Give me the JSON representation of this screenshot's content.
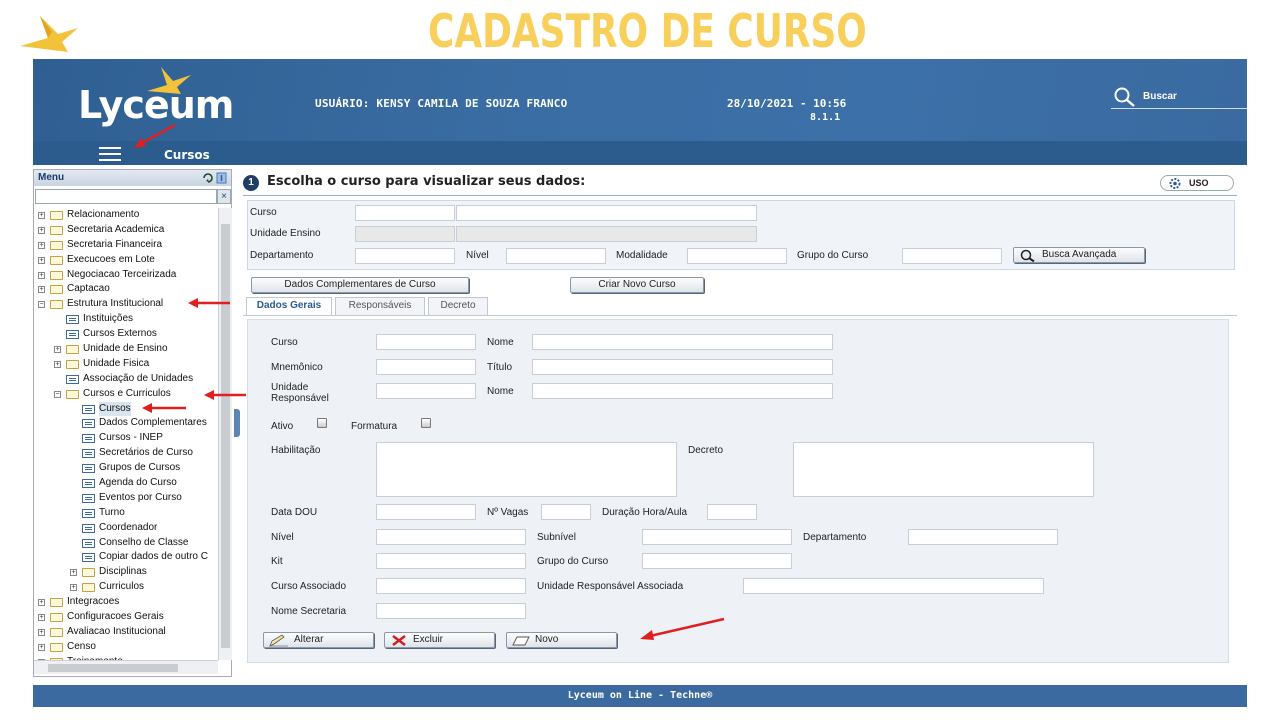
{
  "slide": {
    "title": "CADASTRO DE CURSO"
  },
  "header": {
    "brand": "Lyceum",
    "user": "USUÁRIO: KENSY CAMILA DE SOUZA FRANCO",
    "datetime": "28/10/2021 - 10:56",
    "version": "8.1.1",
    "search_label": "Buscar",
    "section": "Cursos"
  },
  "sidebar": {
    "title": "Menu",
    "clear_label": "×",
    "items": [
      {
        "label": "Relacionamento",
        "level": 0,
        "type": "folder",
        "expander": "+"
      },
      {
        "label": "Secretaria Academica",
        "level": 0,
        "type": "folder",
        "expander": "+"
      },
      {
        "label": "Secretaria Financeira",
        "level": 0,
        "type": "folder",
        "expander": "+"
      },
      {
        "label": "Execucoes em Lote",
        "level": 0,
        "type": "folder",
        "expander": "+"
      },
      {
        "label": "Negociacao Terceirizada",
        "level": 0,
        "type": "folder",
        "expander": "+"
      },
      {
        "label": "Captacao",
        "level": 0,
        "type": "folder",
        "expander": "+"
      },
      {
        "label": "Estrutura Institucional",
        "level": 0,
        "type": "folder",
        "expander": "−"
      },
      {
        "label": "Instituições",
        "level": 1,
        "type": "page"
      },
      {
        "label": "Cursos Externos",
        "level": 1,
        "type": "page"
      },
      {
        "label": "Unidade de Ensino",
        "level": 1,
        "type": "folder",
        "expander": "+"
      },
      {
        "label": "Unidade Fisica",
        "level": 1,
        "type": "folder",
        "expander": "+"
      },
      {
        "label": "Associação de Unidades",
        "level": 1,
        "type": "page"
      },
      {
        "label": "Cursos e Curriculos",
        "level": 1,
        "type": "folder",
        "expander": "−"
      },
      {
        "label": "Cursos",
        "level": 2,
        "type": "page",
        "selected": true
      },
      {
        "label": "Dados Complementares",
        "level": 2,
        "type": "page"
      },
      {
        "label": "Cursos - INEP",
        "level": 2,
        "type": "page"
      },
      {
        "label": "Secretários de Curso",
        "level": 2,
        "type": "page"
      },
      {
        "label": "Grupos de Cursos",
        "level": 2,
        "type": "page"
      },
      {
        "label": "Agenda do Curso",
        "level": 2,
        "type": "page"
      },
      {
        "label": "Eventos por Curso",
        "level": 2,
        "type": "page"
      },
      {
        "label": "Turno",
        "level": 2,
        "type": "page"
      },
      {
        "label": "Coordenador",
        "level": 2,
        "type": "page"
      },
      {
        "label": "Conselho de Classe",
        "level": 2,
        "type": "page"
      },
      {
        "label": "Copiar dados de outro C",
        "level": 2,
        "type": "page"
      },
      {
        "label": "Disciplinas",
        "level": 2,
        "type": "folder",
        "expander": "+"
      },
      {
        "label": "Curriculos",
        "level": 2,
        "type": "folder",
        "expander": "+"
      },
      {
        "label": "Integracoes",
        "level": 0,
        "type": "folder",
        "expander": "+"
      },
      {
        "label": "Configuracoes Gerais",
        "level": 0,
        "type": "folder",
        "expander": "+"
      },
      {
        "label": "Avaliacao Institucional",
        "level": 0,
        "type": "folder",
        "expander": "+"
      },
      {
        "label": "Censo",
        "level": 0,
        "type": "folder",
        "expander": "+"
      },
      {
        "label": "Treinamento",
        "level": 0,
        "type": "folder",
        "expander": "+"
      }
    ]
  },
  "main": {
    "step": "1",
    "title": "Escolha o curso para visualizar seus dados:",
    "uso_label": "USO",
    "search": {
      "curso": "Curso",
      "unidade_ensino": "Unidade Ensino",
      "departamento": "Departamento",
      "nivel": "Nível",
      "modalidade": "Modalidade",
      "grupo_curso": "Grupo do Curso",
      "busca_avancada": "Busca Avançada"
    },
    "buttons": {
      "dados_complementares": "Dados Complementares de Curso",
      "criar_novo": "Criar Novo Curso",
      "alterar": "Alterar",
      "excluir": "Excluir",
      "novo": "Novo"
    },
    "tabs": [
      "Dados Gerais",
      "Responsáveis",
      "Decreto"
    ],
    "form": {
      "curso": "Curso",
      "nome": "Nome",
      "mnemonico": "Mnemônico",
      "titulo": "Título",
      "unidade_responsavel_1": "Unidade",
      "unidade_responsavel_2": "Responsável",
      "nome2": "Nome",
      "ativo": "Ativo",
      "formatura": "Formatura",
      "habilitacao": "Habilitação",
      "decreto": "Decreto",
      "data_dou": "Data DOU",
      "n_vagas": "Nº Vagas",
      "duracao": "Duração Hora/Aula",
      "nivel": "Nível",
      "subnivel": "Subnível",
      "departamento": "Departamento",
      "kit": "Kit",
      "grupo_curso": "Grupo do Curso",
      "curso_associado": "Curso Associado",
      "unidade_resp_assoc": "Unidade Responsável Associada",
      "nome_secretaria": "Nome Secretaria"
    }
  },
  "footer": {
    "text": "Lyceum on Line - Techne®"
  },
  "colors": {
    "header": "#3a6aa0",
    "title_accent": "#f7cf5a",
    "annotation_arrow": "#e02020"
  }
}
